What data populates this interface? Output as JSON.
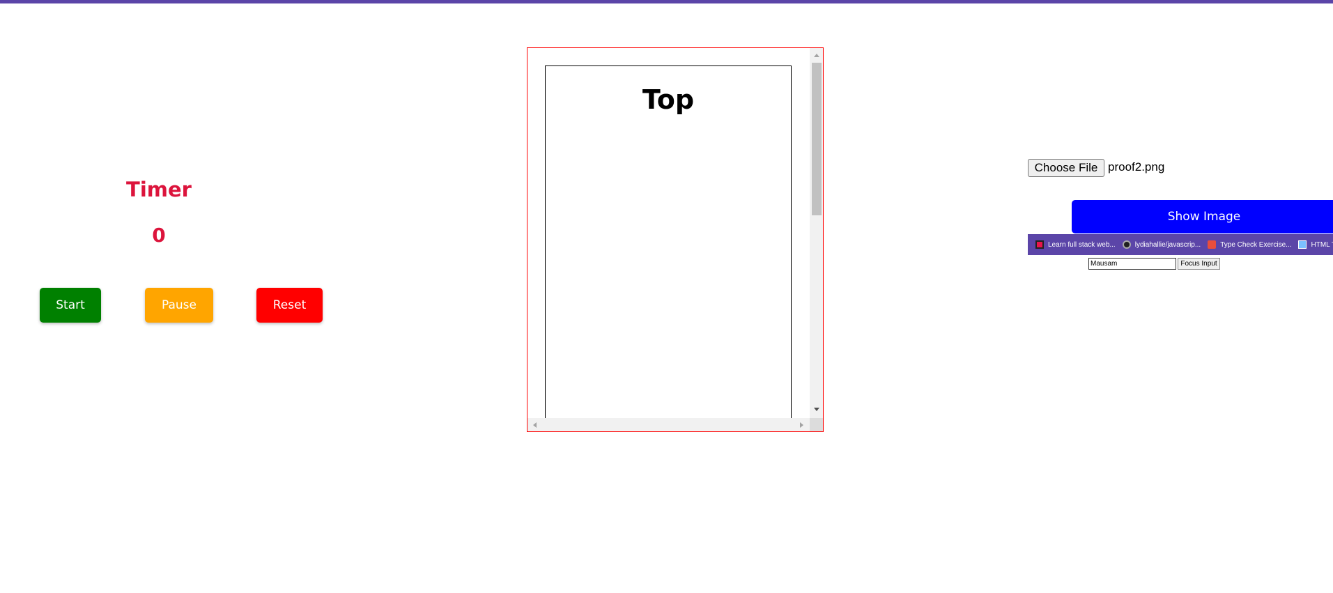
{
  "timer": {
    "title": "Timer",
    "value": "0",
    "buttons": {
      "start": "Start",
      "pause": "Pause",
      "reset": "Reset"
    }
  },
  "scroll_box": {
    "heading": "Top"
  },
  "file_input": {
    "button_label": "Choose File",
    "file_name": "proof2.png"
  },
  "show_image_button": "Show Image",
  "preview": {
    "bookmarks": [
      {
        "label": "Learn full stack web...",
        "icon": "lb-logo-icon"
      },
      {
        "label": "lydiahallie/javascrip...",
        "icon": "github-icon"
      },
      {
        "label": "Type Check Exercise...",
        "icon": "geeksforgeeks-icon"
      },
      {
        "label": "HTML Tutorials | B",
        "icon": "html-icon"
      }
    ],
    "input_value": "Mausam",
    "focus_button": "Focus Input"
  },
  "colors": {
    "top_bar": "#5b45a8",
    "timer_text": "#dc143c",
    "start": "#008000",
    "pause": "#ffa500",
    "reset": "#ff0000",
    "show_image": "#0000ff",
    "scroll_border": "#ff0000"
  }
}
